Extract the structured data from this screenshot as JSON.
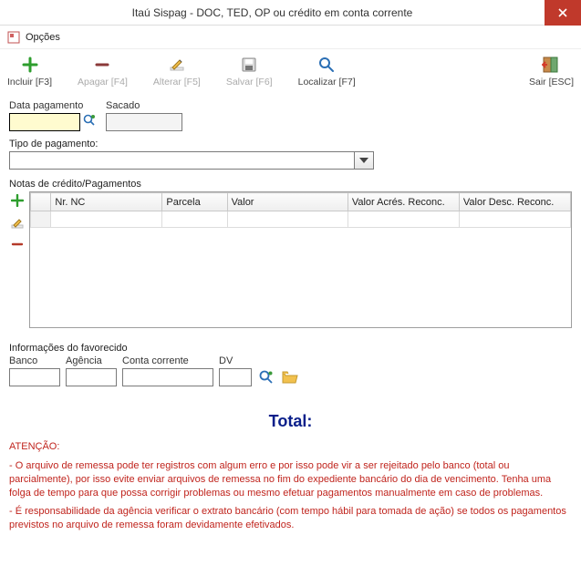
{
  "window": {
    "title": "Itaú Sispag - DOC, TED, OP ou crédito em conta corrente"
  },
  "opcoes": {
    "label": "Opções"
  },
  "toolbar": {
    "include": "Incluir [F3]",
    "delete": "Apagar [F4]",
    "edit": "Alterar [F5]",
    "save": "Salvar [F6]",
    "find": "Localizar [F7]",
    "exit": "Sair [ESC]"
  },
  "fields": {
    "data_pagamento": {
      "label": "Data pagamento",
      "value": ""
    },
    "sacado": {
      "label": "Sacado",
      "value": ""
    },
    "tipo_pagamento": {
      "label": "Tipo de pagamento:",
      "value": ""
    }
  },
  "grid": {
    "title": "Notas de crédito/Pagamentos",
    "columns": [
      "",
      "Nr. NC",
      "Parcela",
      "Valor",
      "Valor Acrés. Reconc.",
      "Valor Desc. Reconc."
    ],
    "rows": [
      [
        "",
        "",
        "",
        "",
        "",
        ""
      ]
    ]
  },
  "favorecido": {
    "title": "Informações do favorecido",
    "banco": {
      "label": "Banco",
      "value": ""
    },
    "agencia": {
      "label": "Agência",
      "value": ""
    },
    "conta": {
      "label": "Conta corrente",
      "value": ""
    },
    "dv": {
      "label": "DV",
      "value": ""
    }
  },
  "total": {
    "label": "Total:"
  },
  "warning": {
    "head": "ATENÇÃO:",
    "p1": "- O arquivo de remessa pode ter registros com algum erro e por isso pode vir a ser rejeitado pelo banco (total ou parcialmente), por isso evite enviar arquivos de remessa no fim do expediente bancário do dia de vencimento. Tenha uma folga de tempo para que possa corrigir problemas ou mesmo efetuar pagamentos manualmente em caso de problemas.",
    "p2": "- É responsabilidade da agência verificar o extrato bancário (com tempo hábil para tomada de ação) se todos os pagamentos previstos no arquivo de remessa foram devidamente efetivados."
  }
}
